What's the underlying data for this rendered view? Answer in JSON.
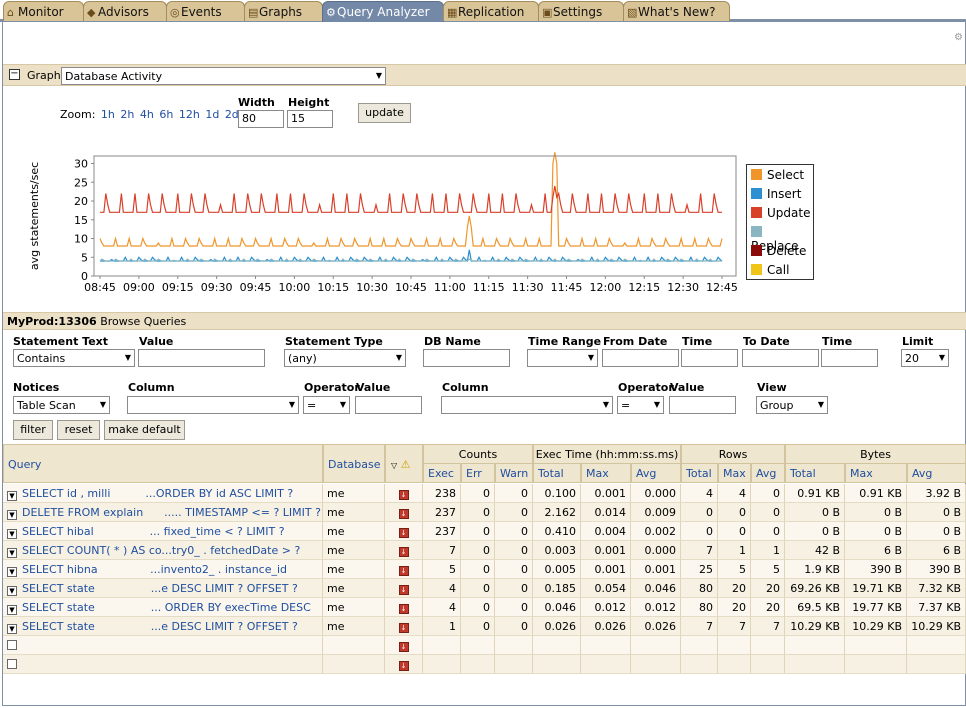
{
  "tabs": [
    {
      "label": "Monitor",
      "icon": "home-icon",
      "active": false
    },
    {
      "label": "Advisors",
      "icon": "shield-icon",
      "active": false
    },
    {
      "label": "Events",
      "icon": "alarm-icon",
      "active": false
    },
    {
      "label": "Graphs",
      "icon": "graph-icon",
      "active": false
    },
    {
      "label": "Query Analyzer",
      "icon": "query-icon",
      "active": true
    },
    {
      "label": "Replication",
      "icon": "replication-icon",
      "active": false
    },
    {
      "label": "Settings",
      "icon": "settings-icon",
      "active": false
    },
    {
      "label": "What's New?",
      "icon": "news-icon",
      "active": false
    }
  ],
  "graph": {
    "label": "Graph:",
    "selected": "Database Activity",
    "zoom_label": "Zoom:",
    "zoom_options": [
      "1h",
      "2h",
      "4h",
      "6h",
      "12h",
      "1d",
      "2d"
    ],
    "width_label": "Width",
    "height_label": "Height",
    "width_value": "80",
    "height_value": "15",
    "update_label": "update"
  },
  "chart_data": {
    "type": "line",
    "ylabel": "avg statements/sec",
    "xlabel": "",
    "ylim": [
      0,
      32
    ],
    "yticks": [
      "0",
      "5",
      "10",
      "15",
      "20",
      "25",
      "30"
    ],
    "categories": [
      "08:45",
      "09:00",
      "09:15",
      "09:30",
      "09:45",
      "10:00",
      "10:15",
      "10:30",
      "10:45",
      "11:00",
      "11:15",
      "11:30",
      "11:45",
      "12:00",
      "12:15",
      "12:30",
      "12:45"
    ],
    "legend_position": "right",
    "series": [
      {
        "name": "Select",
        "color": "#f0952a",
        "baseline": 8,
        "peak": 10,
        "spikes": [
          [
            9.5,
            16
          ],
          [
            11.7,
            33
          ]
        ]
      },
      {
        "name": "Insert",
        "color": "#2b8fd1",
        "baseline": 4,
        "peak": 5,
        "spikes": [
          [
            9.5,
            7
          ]
        ]
      },
      {
        "name": "Update",
        "color": "#d8402a",
        "baseline": 17,
        "peak": 22,
        "spikes": [
          [
            11.7,
            24
          ]
        ]
      },
      {
        "name": "Replace",
        "color": "#8ab6c2",
        "baseline": 4,
        "peak": 4.5,
        "spikes": []
      },
      {
        "name": "Delete",
        "color": "#8b0b0b",
        "baseline": 0,
        "peak": 0,
        "spikes": []
      },
      {
        "name": "Call",
        "color": "#f0c419",
        "baseline": 0,
        "peak": 0,
        "spikes": []
      }
    ]
  },
  "browse": {
    "server": "MyProd:13306",
    "title": "Browse Queries"
  },
  "filters": {
    "statement_text_label": "Statement Text",
    "statement_text_value": "Contains",
    "value_label": "Value",
    "statement_type_label": "Statement Type",
    "statement_type_value": "(any)",
    "db_name_label": "DB Name",
    "time_range_label": "Time Range",
    "from_date_label": "From Date",
    "time_label": "Time",
    "to_date_label": "To Date",
    "time2_label": "Time",
    "limit_label": "Limit",
    "limit_value": "20",
    "notices_label": "Notices",
    "notices_value": "Table Scan",
    "column_label": "Column",
    "operator_label": "Operator",
    "operator_value": "=",
    "value2_label": "Value",
    "column2_label": "Column",
    "operator2_label": "Operator",
    "operator2_value": "=",
    "value3_label": "Value",
    "view_label": "View",
    "view_value": "Group",
    "filter_button": "filter",
    "reset_button": "reset",
    "default_button": "make default"
  },
  "table": {
    "headers": {
      "query": "Query",
      "database": "Database",
      "counts": "Counts",
      "exec_time": "Exec Time (hh:mm:ss.ms)",
      "rows": "Rows",
      "bytes": "Bytes",
      "exec": "Exec",
      "err": "Err",
      "warn": "Warn",
      "total": "Total",
      "max": "Max",
      "avg": "Avg"
    },
    "rows": [
      {
        "query": "SELECT id , milli          ...ORDER BY id ASC LIMIT ?",
        "db": "me",
        "exec": "238",
        "err": "0",
        "warn": "0",
        "t_total": "0.100",
        "t_max": "0.001",
        "t_avg": "0.000",
        "r_total": "4",
        "r_max": "4",
        "r_avg": "0",
        "b_total": "0.91 KB",
        "b_max": "0.91 KB",
        "b_avg": "3.92 B"
      },
      {
        "query": "DELETE FROM explain      ..... TIMESTAMP <= ? LIMIT ?",
        "db": "me",
        "exec": "237",
        "err": "0",
        "warn": "0",
        "t_total": "2.162",
        "t_max": "0.014",
        "t_avg": "0.009",
        "r_total": "0",
        "r_max": "0",
        "r_avg": "0",
        "b_total": "0 B",
        "b_max": "0 B",
        "b_avg": "0 B"
      },
      {
        "query": "SELECT hibal                ... fixed_time < ? LIMIT ?",
        "db": "me",
        "exec": "237",
        "err": "0",
        "warn": "0",
        "t_total": "0.410",
        "t_max": "0.004",
        "t_avg": "0.002",
        "r_total": "0",
        "r_max": "0",
        "r_avg": "0",
        "b_total": "0 B",
        "b_max": "0 B",
        "b_avg": "0 B"
      },
      {
        "query": "SELECT COUNT( * ) AS co...try0_ . fetchedDate > ?",
        "db": "me",
        "exec": "7",
        "err": "0",
        "warn": "0",
        "t_total": "0.003",
        "t_max": "0.001",
        "t_avg": "0.000",
        "r_total": "7",
        "r_max": "1",
        "r_avg": "1",
        "b_total": "42 B",
        "b_max": "6 B",
        "b_avg": "6 B"
      },
      {
        "query": "SELECT hibna               ...invento2_ . instance_id",
        "db": "me",
        "exec": "5",
        "err": "0",
        "warn": "0",
        "t_total": "0.005",
        "t_max": "0.001",
        "t_avg": "0.001",
        "r_total": "25",
        "r_max": "5",
        "r_avg": "5",
        "b_total": "1.9 KB",
        "b_max": "390 B",
        "b_avg": "390 B"
      },
      {
        "query": "SELECT state                ...e DESC LIMIT ? OFFSET ?",
        "db": "me",
        "exec": "4",
        "err": "0",
        "warn": "0",
        "t_total": "0.185",
        "t_max": "0.054",
        "t_avg": "0.046",
        "r_total": "80",
        "r_max": "20",
        "r_avg": "20",
        "b_total": "69.26 KB",
        "b_max": "19.71 KB",
        "b_avg": "7.32 KB"
      },
      {
        "query": "SELECT state                ... ORDER BY execTime DESC",
        "db": "me",
        "exec": "4",
        "err": "0",
        "warn": "0",
        "t_total": "0.046",
        "t_max": "0.012",
        "t_avg": "0.012",
        "r_total": "80",
        "r_max": "20",
        "r_avg": "20",
        "b_total": "69.5 KB",
        "b_max": "19.77 KB",
        "b_avg": "7.37 KB"
      },
      {
        "query": "SELECT state                ...e DESC LIMIT ? OFFSET ?",
        "db": "me",
        "exec": "1",
        "err": "0",
        "warn": "0",
        "t_total": "0.026",
        "t_max": "0.026",
        "t_avg": "0.026",
        "r_total": "7",
        "r_max": "7",
        "r_avg": "7",
        "b_total": "10.29 KB",
        "b_max": "10.29 KB",
        "b_avg": "10.29 KB"
      }
    ]
  }
}
